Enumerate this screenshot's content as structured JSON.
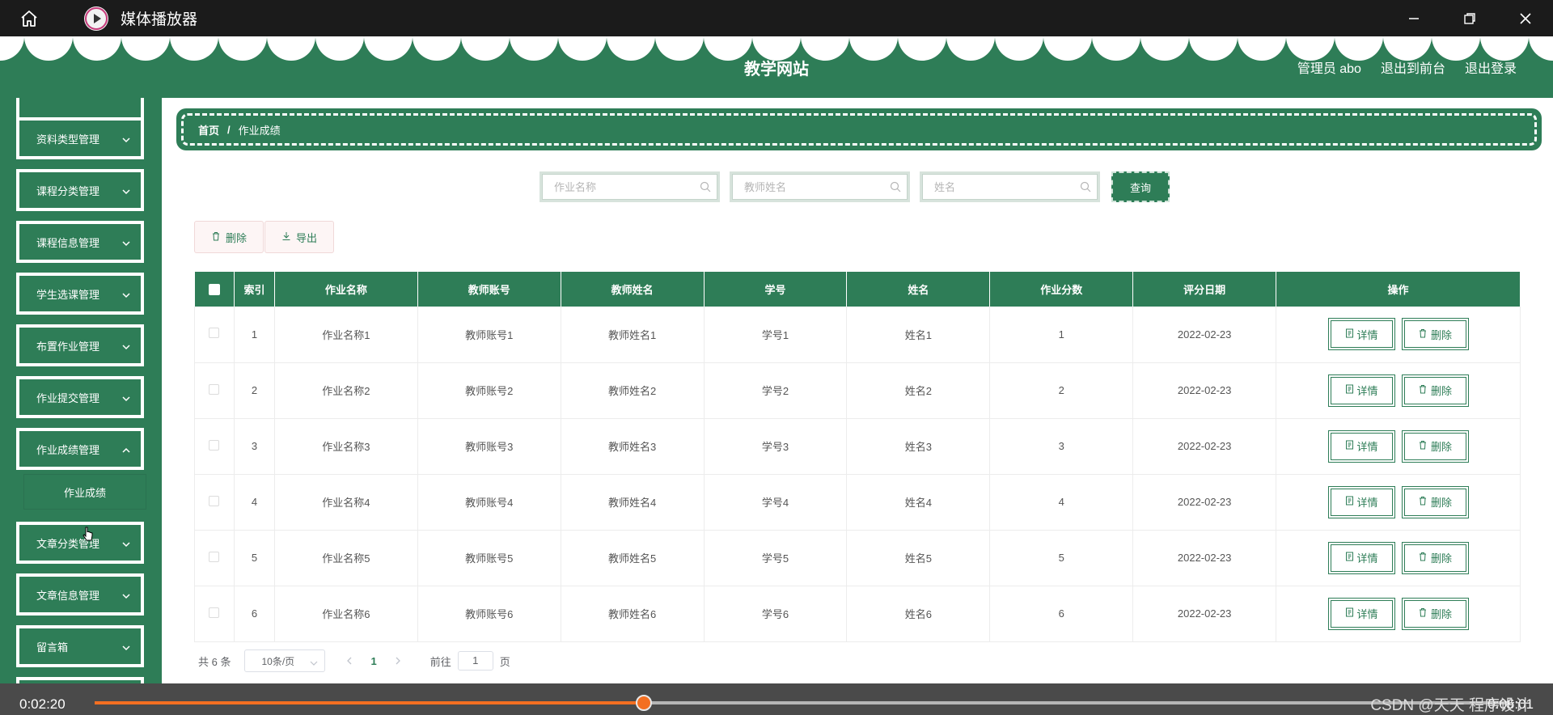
{
  "window": {
    "title": "媒体播放器",
    "icons": {
      "home": "home-icon",
      "app": "play-circle-icon",
      "minimize": "minimize-icon",
      "restore": "restore-icon",
      "close": "close-icon"
    }
  },
  "header": {
    "site_title": "教学网站",
    "admin": "管理员 abo",
    "to_front": "退出到前台",
    "logout": "退出登录"
  },
  "sidebar": {
    "items": [
      {
        "label": "资料类型管理"
      },
      {
        "label": "课程分类管理"
      },
      {
        "label": "课程信息管理"
      },
      {
        "label": "学生选课管理"
      },
      {
        "label": "布置作业管理"
      },
      {
        "label": "作业提交管理"
      },
      {
        "label": "作业成绩管理"
      },
      {
        "label": "文章分类管理"
      },
      {
        "label": "文章信息管理"
      },
      {
        "label": "留言箱"
      }
    ],
    "submenu": {
      "label": "作业成绩"
    }
  },
  "breadcrumb": {
    "home": "首页",
    "separator": "/",
    "current": "作业成绩"
  },
  "search": {
    "homework_name_placeholder": "作业名称",
    "teacher_name_placeholder": "教师姓名",
    "name_placeholder": "姓名",
    "query_label": "查询"
  },
  "actions": {
    "delete_label": "删除",
    "export_label": "导出"
  },
  "table": {
    "columns": [
      "索引",
      "作业名称",
      "教师账号",
      "教师姓名",
      "学号",
      "姓名",
      "作业分数",
      "评分日期",
      "操作"
    ],
    "detail_label": "详情",
    "delete_label": "删除",
    "rows": [
      {
        "index": "1",
        "homework": "作业名称1",
        "teacher_account": "教师账号1",
        "teacher_name": "教师姓名1",
        "student_no": "学号1",
        "name": "姓名1",
        "score": "1",
        "date": "2022-02-23"
      },
      {
        "index": "2",
        "homework": "作业名称2",
        "teacher_account": "教师账号2",
        "teacher_name": "教师姓名2",
        "student_no": "学号2",
        "name": "姓名2",
        "score": "2",
        "date": "2022-02-23"
      },
      {
        "index": "3",
        "homework": "作业名称3",
        "teacher_account": "教师账号3",
        "teacher_name": "教师姓名3",
        "student_no": "学号3",
        "name": "姓名3",
        "score": "3",
        "date": "2022-02-23"
      },
      {
        "index": "4",
        "homework": "作业名称4",
        "teacher_account": "教师账号4",
        "teacher_name": "教师姓名4",
        "student_no": "学号4",
        "name": "姓名4",
        "score": "4",
        "date": "2022-02-23"
      },
      {
        "index": "5",
        "homework": "作业名称5",
        "teacher_account": "教师账号5",
        "teacher_name": "教师姓名5",
        "student_no": "学号5",
        "name": "姓名5",
        "score": "5",
        "date": "2022-02-23"
      },
      {
        "index": "6",
        "homework": "作业名称6",
        "teacher_account": "教师账号6",
        "teacher_name": "教师姓名6",
        "student_no": "学号6",
        "name": "姓名6",
        "score": "6",
        "date": "2022-02-23"
      }
    ]
  },
  "pagination": {
    "total": "共 6 条",
    "page_size": "10条/页",
    "current_page": "1",
    "goto_prefix": "前往",
    "goto_value": "1",
    "goto_suffix": "页"
  },
  "player": {
    "elapsed": "0:02:20",
    "duration": "0:06:01",
    "progress_fraction": 0.388,
    "watermark": "CSDN @天天 程序设计"
  },
  "colors": {
    "primary": "#2e7d57",
    "progress": "#f36f21",
    "titlebar": "#1b1b1b"
  }
}
